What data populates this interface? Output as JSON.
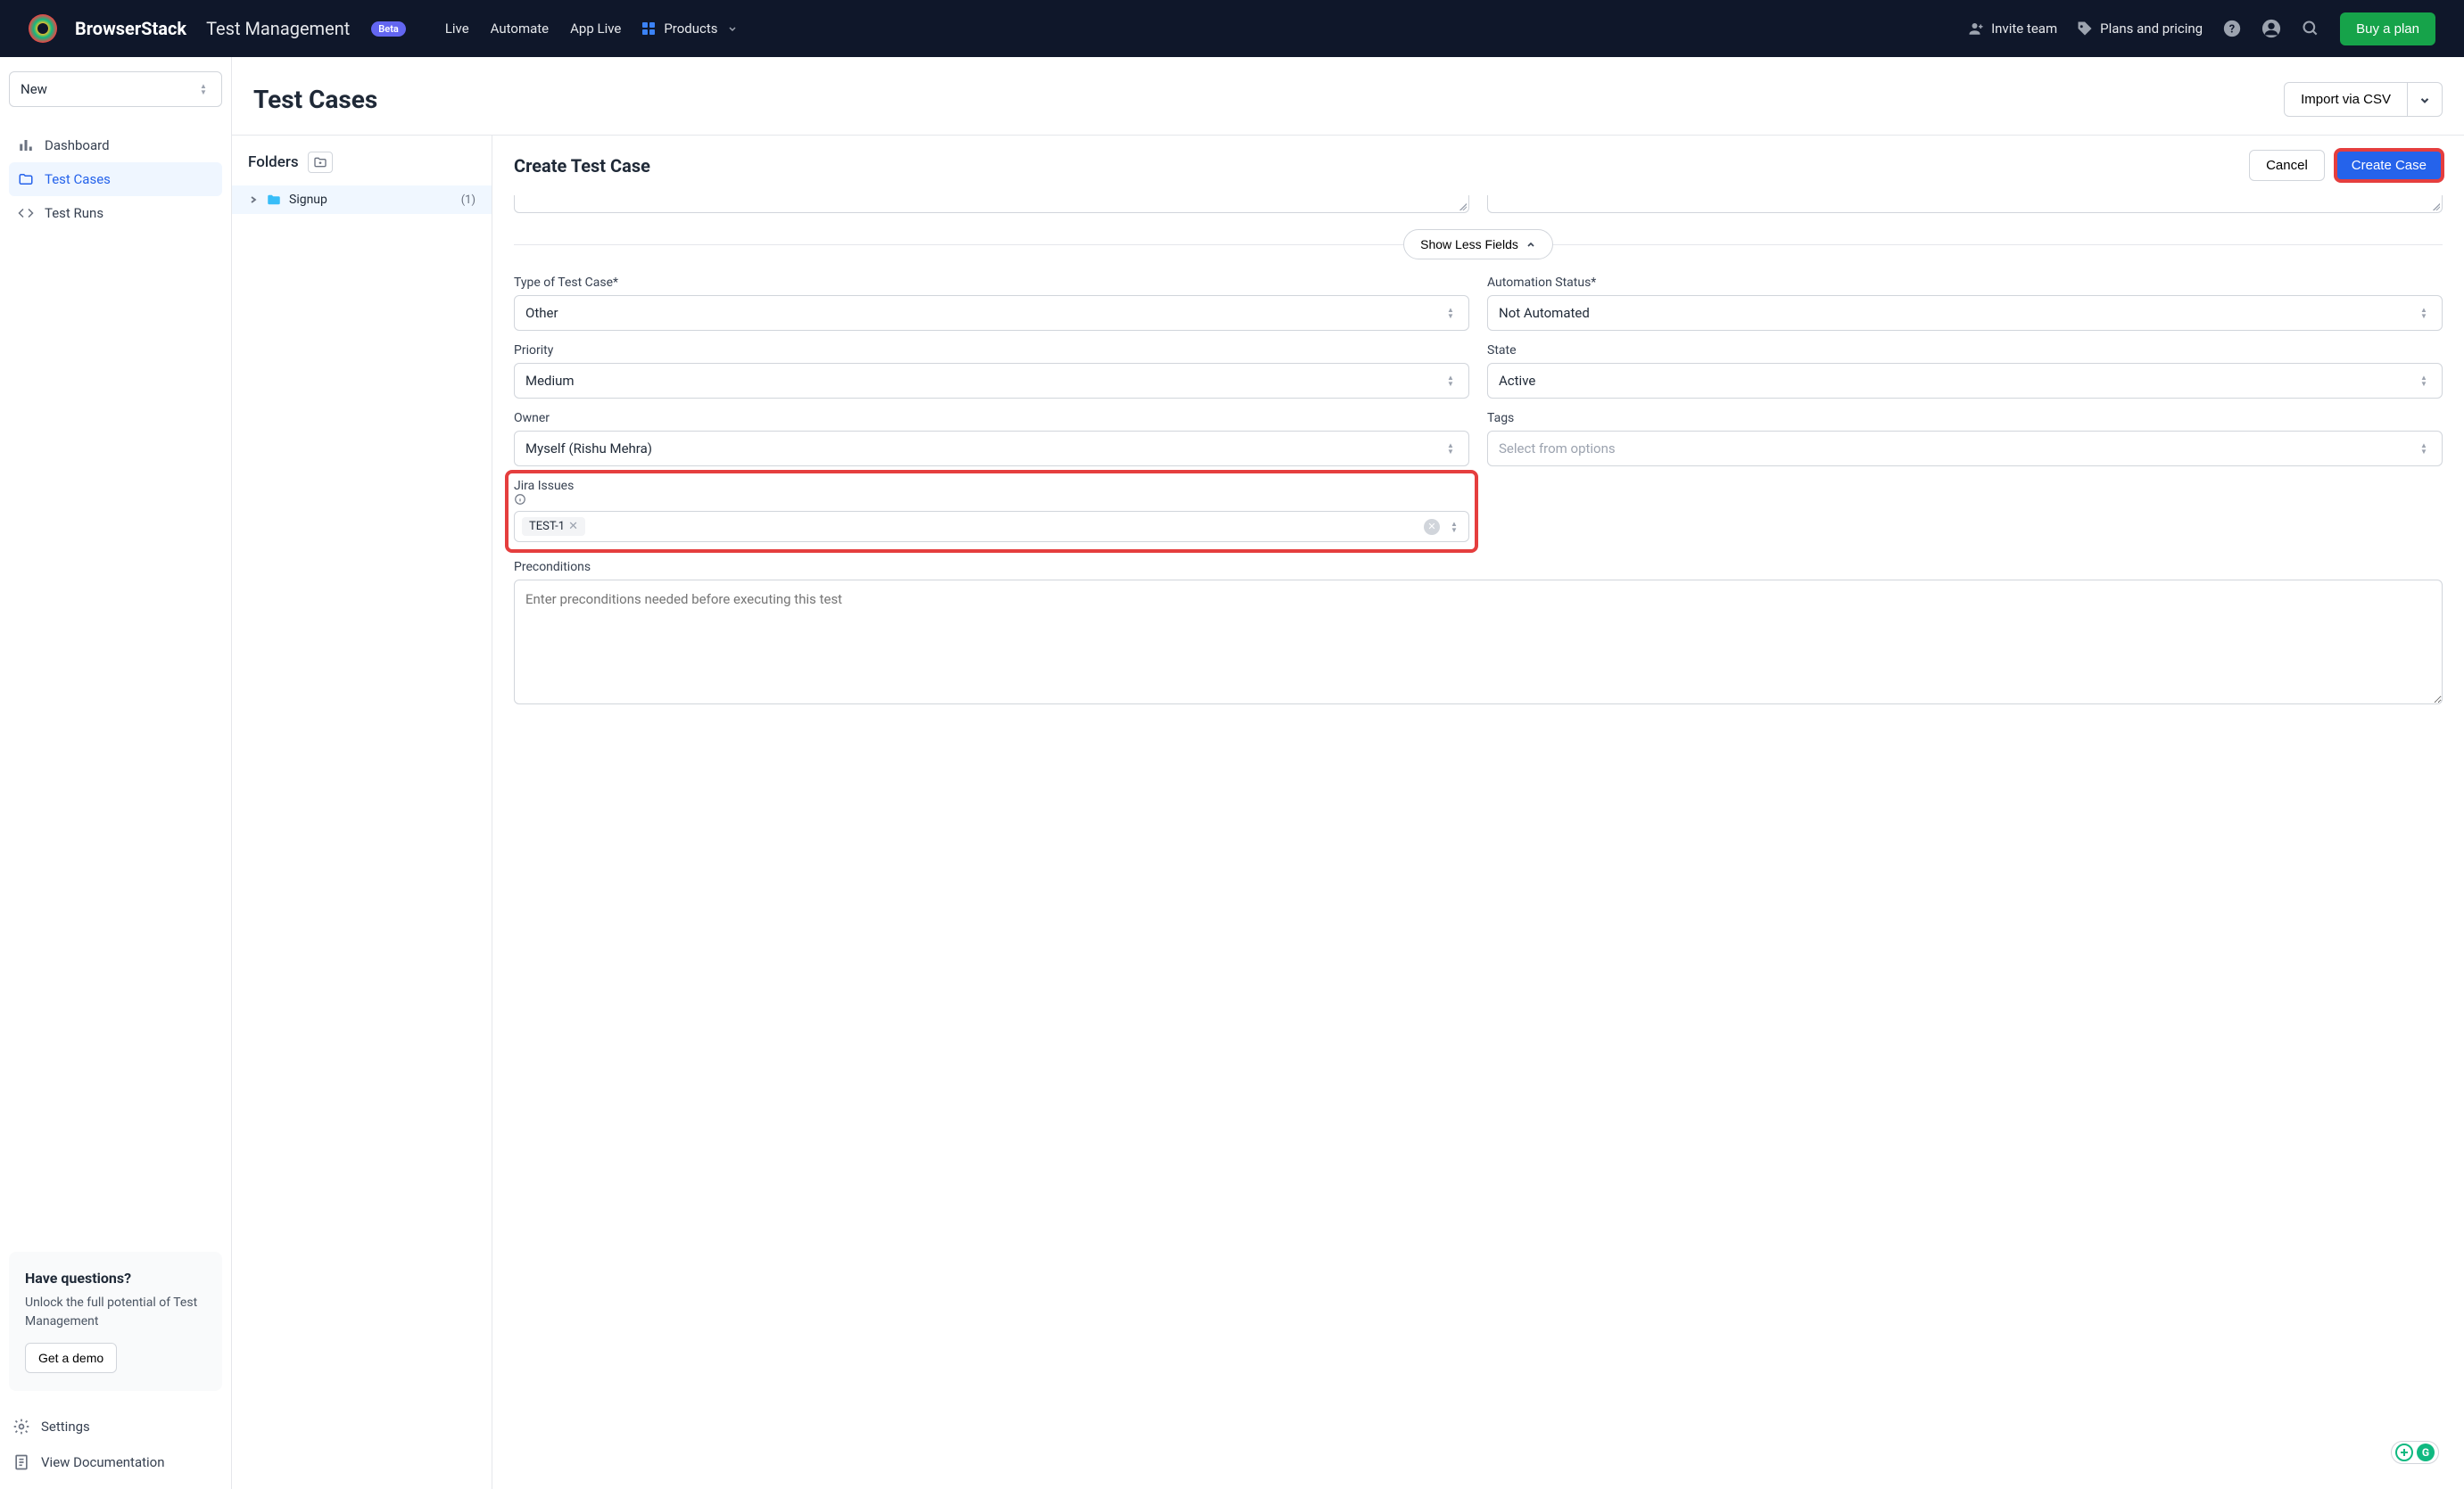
{
  "nav": {
    "brand": "BrowserStack",
    "brand_sub": "Test Management",
    "beta": "Beta",
    "links": [
      "Live",
      "Automate",
      "App Live",
      "Products"
    ],
    "invite": "Invite team",
    "pricing": "Plans and pricing",
    "buy": "Buy a plan"
  },
  "sidebar": {
    "project": "New",
    "items": [
      {
        "label": "Dashboard"
      },
      {
        "label": "Test Cases"
      },
      {
        "label": "Test Runs"
      }
    ],
    "demo": {
      "title": "Have questions?",
      "body": "Unlock the full potential of Test Management",
      "cta": "Get a demo"
    },
    "settings": "Settings",
    "docs": "View Documentation"
  },
  "page": {
    "title": "Test Cases",
    "import": "Import via CSV"
  },
  "folders": {
    "heading": "Folders",
    "items": [
      {
        "name": "Signup",
        "count": "(1)"
      }
    ]
  },
  "form": {
    "title": "Create Test Case",
    "cancel": "Cancel",
    "submit": "Create Case",
    "toggle": "Show Less Fields",
    "fields": {
      "type_label": "Type of Test Case*",
      "type_value": "Other",
      "automation_label": "Automation Status*",
      "automation_value": "Not Automated",
      "priority_label": "Priority",
      "priority_value": "Medium",
      "state_label": "State",
      "state_value": "Active",
      "owner_label": "Owner",
      "owner_value": "Myself (Rishu Mehra)",
      "tags_label": "Tags",
      "tags_placeholder": "Select from options",
      "jira_label": "Jira Issues",
      "jira_chip": "TEST-1",
      "precond_label": "Preconditions",
      "precond_placeholder": "Enter preconditions needed before executing this test"
    }
  }
}
